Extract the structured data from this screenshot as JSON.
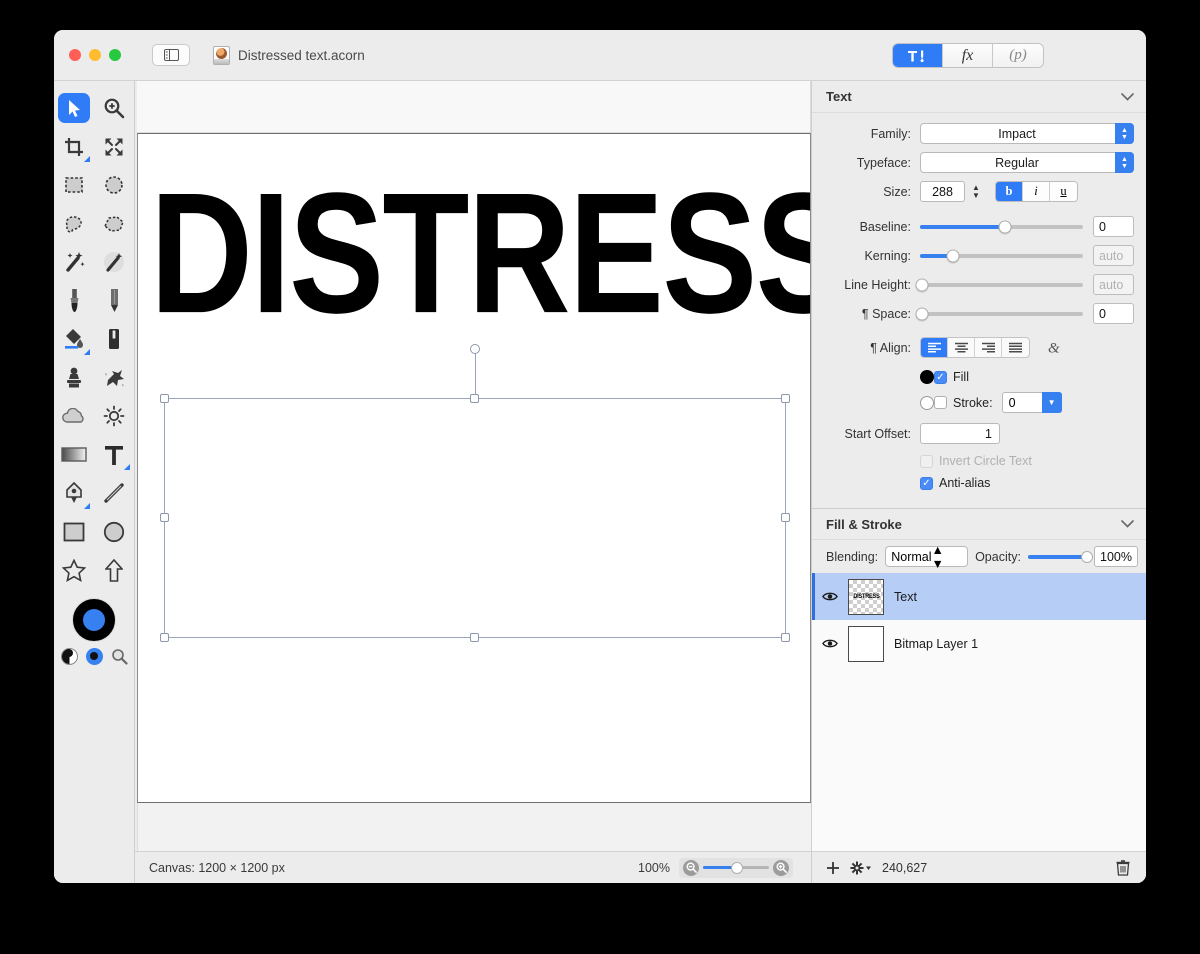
{
  "window": {
    "document_title": "Distressed text.acorn",
    "traffic_lights": [
      "close",
      "minimize",
      "zoom"
    ],
    "sidebar_toggle_icon": "sidebar-icon"
  },
  "inspector_tabs": [
    {
      "id": "tools",
      "icon": "hammer-pen-icon",
      "label": "",
      "active": true
    },
    {
      "id": "fx",
      "icon": "fx-icon",
      "label": "fx",
      "active": false
    },
    {
      "id": "palette",
      "icon": "p-icon",
      "label": "(p)",
      "active": false
    }
  ],
  "toolbar": {
    "tools": [
      {
        "name": "move-tool",
        "icon": "arrow-cursor-icon",
        "selected": true,
        "corner": false
      },
      {
        "name": "zoom-tool",
        "icon": "magnifier-plus-icon",
        "selected": false,
        "corner": false
      },
      {
        "name": "crop-tool",
        "icon": "crop-icon",
        "selected": false,
        "corner": true
      },
      {
        "name": "transform-tool",
        "icon": "four-arrows-icon",
        "selected": false,
        "corner": false
      },
      {
        "name": "rectangular-marquee-tool",
        "icon": "dashed-rectangle-icon",
        "selected": false,
        "corner": false
      },
      {
        "name": "elliptical-marquee-tool",
        "icon": "dashed-ellipse-icon",
        "selected": false,
        "corner": false
      },
      {
        "name": "lasso-tool",
        "icon": "lasso-icon",
        "selected": false,
        "corner": false
      },
      {
        "name": "polygon-lasso-tool",
        "icon": "polygon-lasso-icon",
        "selected": false,
        "corner": false
      },
      {
        "name": "magic-wand-tool",
        "icon": "magic-wand-icon",
        "selected": false,
        "corner": false
      },
      {
        "name": "instant-alpha-tool",
        "icon": "magic-wand-dotted-icon",
        "selected": false,
        "corner": false
      },
      {
        "name": "brush-tool",
        "icon": "brush-icon",
        "selected": false,
        "corner": false
      },
      {
        "name": "pencil-tool",
        "icon": "pencil-icon",
        "selected": false,
        "corner": false
      },
      {
        "name": "paint-bucket-tool",
        "icon": "paint-bucket-icon",
        "selected": false,
        "corner": true
      },
      {
        "name": "eraser-tool",
        "icon": "eraser-icon",
        "selected": false,
        "corner": false
      },
      {
        "name": "clone-stamp-tool",
        "icon": "clone-stamp-icon",
        "selected": false,
        "corner": false
      },
      {
        "name": "smudge-tool",
        "icon": "smudge-splatter-icon",
        "selected": false,
        "corner": false
      },
      {
        "name": "blur-tool",
        "icon": "cloud-blur-icon",
        "selected": false,
        "corner": false
      },
      {
        "name": "dodge-tool",
        "icon": "sun-dodge-icon",
        "selected": false,
        "corner": false
      },
      {
        "name": "gradient-tool",
        "icon": "gradient-icon",
        "selected": false,
        "corner": false
      },
      {
        "name": "text-tool",
        "icon": "text-t-icon",
        "selected": false,
        "corner": true
      },
      {
        "name": "bezier-pen-tool",
        "icon": "pen-nib-icon",
        "selected": false,
        "corner": true
      },
      {
        "name": "line-tool",
        "icon": "line-icon",
        "selected": false,
        "corner": false
      },
      {
        "name": "rectangle-tool",
        "icon": "rectangle-icon",
        "selected": false,
        "corner": false
      },
      {
        "name": "ellipse-tool",
        "icon": "ellipse-icon",
        "selected": false,
        "corner": false
      },
      {
        "name": "star-tool",
        "icon": "star-icon",
        "selected": false,
        "corner": false
      },
      {
        "name": "arrow-shape-tool",
        "icon": "arrow-up-shape-icon",
        "selected": false,
        "corner": false
      }
    ],
    "color_well": {
      "outer": "#000000",
      "inner": "#3680f0"
    },
    "mini_swatches": [
      {
        "name": "default-colors-swatch",
        "icon": "half-black-white-icon"
      },
      {
        "name": "foreground-color-swatch",
        "icon": "blue-black-circle-icon"
      },
      {
        "name": "color-picker-magnifier",
        "icon": "magnifier-icon"
      }
    ]
  },
  "canvas": {
    "artwork_text": "DISTRESS",
    "selection": {
      "handles": 8,
      "rotation_handle": true
    }
  },
  "text_panel": {
    "title": "Text",
    "family": {
      "label": "Family:",
      "value": "Impact"
    },
    "typeface": {
      "label": "Typeface:",
      "value": "Regular"
    },
    "size": {
      "label": "Size:",
      "value": "288"
    },
    "style_buttons": [
      {
        "name": "bold-button",
        "label": "b",
        "active": true
      },
      {
        "name": "italic-button",
        "label": "i",
        "active": false
      },
      {
        "name": "underline-button",
        "label": "u",
        "active": false
      }
    ],
    "baseline": {
      "label": "Baseline:",
      "value": "0",
      "slider_pct": 52
    },
    "kerning": {
      "label": "Kerning:",
      "value": "auto",
      "slider_pct": 20,
      "dim": true
    },
    "line_height": {
      "label": "Line Height:",
      "value": "auto",
      "slider_pct": 0,
      "dim": true
    },
    "space": {
      "label": "¶ Space:",
      "value": "0",
      "slider_pct": 0
    },
    "align": {
      "label": "¶ Align:",
      "options": [
        "align-left",
        "align-center",
        "align-right",
        "align-justify"
      ],
      "selected": 0,
      "ligature_icon": "ampersand-icon"
    },
    "fill": {
      "label": "Fill",
      "checked": true,
      "swatch": "#000000"
    },
    "stroke": {
      "label": "Stroke:",
      "checked": false,
      "swatch": "#ffffff",
      "value": "0"
    },
    "start_offset": {
      "label": "Start Offset:",
      "value": "1"
    },
    "invert_circle_text": {
      "label": "Invert Circle Text",
      "checked": false,
      "disabled": true
    },
    "anti_alias": {
      "label": "Anti-alias",
      "checked": true
    }
  },
  "fill_stroke_panel": {
    "title": "Fill & Stroke",
    "blending": {
      "label": "Blending:",
      "value": "Normal"
    },
    "opacity": {
      "label": "Opacity:",
      "value": "100%",
      "slider_pct": 100
    }
  },
  "layers": [
    {
      "name": "Text",
      "visible": true,
      "selected": true,
      "thumb": "checker",
      "thumb_text": "DISTRESS"
    },
    {
      "name": "Bitmap Layer 1",
      "visible": true,
      "selected": false,
      "thumb": "white",
      "thumb_text": ""
    }
  ],
  "status_bar": {
    "canvas_info": "Canvas: 1200 × 1200 px",
    "zoom_level": "100%",
    "zoom_out_icon": "magnifier-minus-icon",
    "zoom_in_icon": "magnifier-plus-icon",
    "zoom_slider_pct": 52
  },
  "layer_bar": {
    "add_icon": "plus-icon",
    "settings_icon": "gear-icon",
    "coordinates": "240,627",
    "delete_icon": "trash-icon"
  }
}
